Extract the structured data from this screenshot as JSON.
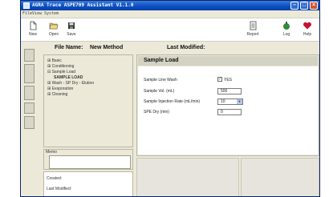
{
  "window": {
    "title": "AGRA Trace ASPE709 Assistant V1.1.0"
  },
  "menu": {
    "items": [
      "File",
      "View",
      "System"
    ]
  },
  "toolbar": {
    "new_label": "New",
    "open_label": "Open",
    "save_label": "Save",
    "report_label": "Report",
    "log_label": "Log",
    "help_label": "Help"
  },
  "file_info": {
    "file_name_label": "File Name:",
    "file_name_value": "New Method",
    "last_modified_label": "Last Modified:"
  },
  "tree": {
    "items": [
      {
        "prefix": "⊞",
        "label": "Basic"
      },
      {
        "prefix": "⊞",
        "label": "Conditioning"
      },
      {
        "prefix": "⊟",
        "label": "Sample Load"
      },
      {
        "prefix": "",
        "label": "SAMPLE LOAD"
      },
      {
        "prefix": "⊞",
        "label": "Wash - SP Dry - Elution"
      },
      {
        "prefix": "⊞",
        "label": "Evaporation"
      },
      {
        "prefix": "⊞",
        "label": "Cleaning"
      }
    ]
  },
  "memo": {
    "label": "Memo",
    "value": ""
  },
  "info": {
    "created_label": "Created:",
    "last_modified_label": "Last Modified:"
  },
  "settings": {
    "header": "Sample Load",
    "sample_line_wash_label": "Sample Line Wash",
    "sample_line_wash_checked": true,
    "sample_line_wash_value": "YES",
    "sample_vol_label": "Sample Vol. (mL)",
    "sample_vol_value": "500",
    "injection_rate_label": "Sample Injection Rate (mL/min)",
    "injection_rate_value": "10",
    "spe_dry_label": "SPE Dry (min)",
    "spe_dry_value": "0"
  },
  "icons": {
    "new": "new-document-icon",
    "open": "open-folder-icon",
    "save": "save-disk-icon",
    "report": "report-icon",
    "log": "log-icon",
    "help": "help-heart-icon"
  },
  "colors": {
    "titlebar": "#0b4fc4",
    "help_icon": "#c8102e",
    "log_icon": "#2e8b3a",
    "checkbox_check": "#1a7a1a"
  }
}
